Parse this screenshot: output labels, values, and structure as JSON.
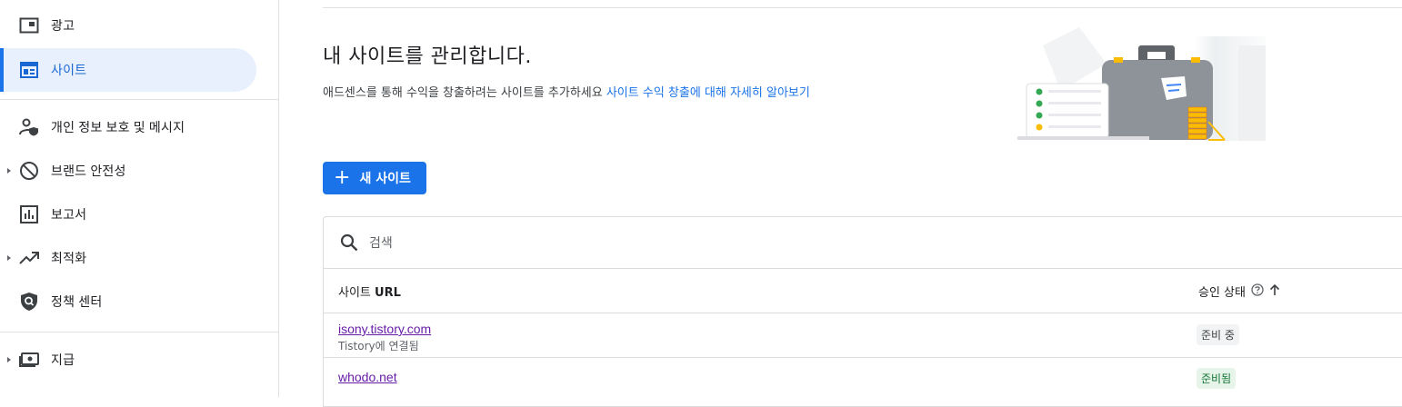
{
  "sidebar": {
    "items": [
      {
        "label": "광고",
        "icon": "ads-icon",
        "expandable": false,
        "active": false
      },
      {
        "label": "사이트",
        "icon": "sites-icon",
        "expandable": false,
        "active": true
      },
      {
        "label": "개인 정보 보호 및 메시지",
        "icon": "privacy-messaging-icon",
        "expandable": false,
        "active": false
      },
      {
        "label": "브랜드 안전성",
        "icon": "block-icon",
        "expandable": true,
        "active": false
      },
      {
        "label": "보고서",
        "icon": "reports-icon",
        "expandable": false,
        "active": false
      },
      {
        "label": "최적화",
        "icon": "trending-up-icon",
        "expandable": true,
        "active": false
      },
      {
        "label": "정책 센터",
        "icon": "policy-shield-icon",
        "expandable": false,
        "active": false
      },
      {
        "label": "지급",
        "icon": "payments-icon",
        "expandable": true,
        "active": false
      }
    ]
  },
  "main": {
    "title": "내 사이트를 관리합니다.",
    "subtitle": "애드센스를 통해 수익을 창출하려는 사이트를 추가하세요",
    "learn_more_link": "사이트 수익 창출에 대해 자세히 알아보기",
    "new_site_button": "새 사이트",
    "search": {
      "placeholder": "검색",
      "value": ""
    },
    "table": {
      "col_url_prefix": "사이트",
      "col_url_bold": "URL",
      "col_status": "승인 상태",
      "sort_direction": "ascending",
      "rows": [
        {
          "url": "isony.tistory.com",
          "sub": "Tistory에 연결됨",
          "status": "준비 중",
          "status_kind": "preparing"
        },
        {
          "url": "whodo.net",
          "sub": "",
          "status": "준비됨",
          "status_kind": "ready"
        }
      ]
    }
  },
  "colors": {
    "accent": "#1a73e8",
    "active_bg": "#e8f0fe",
    "link_visited": "#681da8",
    "ready_bg": "#e6f4ea",
    "ready_text": "#137333"
  }
}
